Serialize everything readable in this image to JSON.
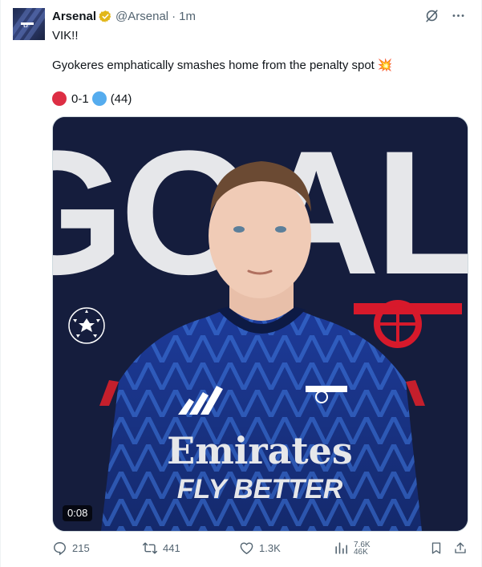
{
  "tweet": {
    "author_name": "Arsenal",
    "handle": "@Arsenal",
    "separator": "·",
    "time_ago": "1m",
    "text_line1": "VIK!!",
    "text_line2": "Gyokeres emphatically smashes home from the penalty spot",
    "text_emoji": "💥",
    "score": "0-1",
    "minute": "(44)",
    "video_duration": "0:08",
    "graphic_word": "GOAL!",
    "kit_sponsor": "Emirates",
    "kit_slogan": "FLY BETTER"
  },
  "actions": {
    "replies": "215",
    "reposts": "441",
    "likes": "1.3K",
    "views_top": "7.6K",
    "views_bottom": "46K"
  },
  "colors": {
    "verified_gold": "#e2b719",
    "arsenal_red": "#d7192b",
    "navy_bg": "#151d3d",
    "muted_text": "#536471"
  },
  "icons": [
    "verified-badge-icon",
    "grok-icon",
    "more-icon",
    "reply-icon",
    "repost-icon",
    "like-icon",
    "views-icon",
    "bookmark-icon",
    "share-icon"
  ]
}
